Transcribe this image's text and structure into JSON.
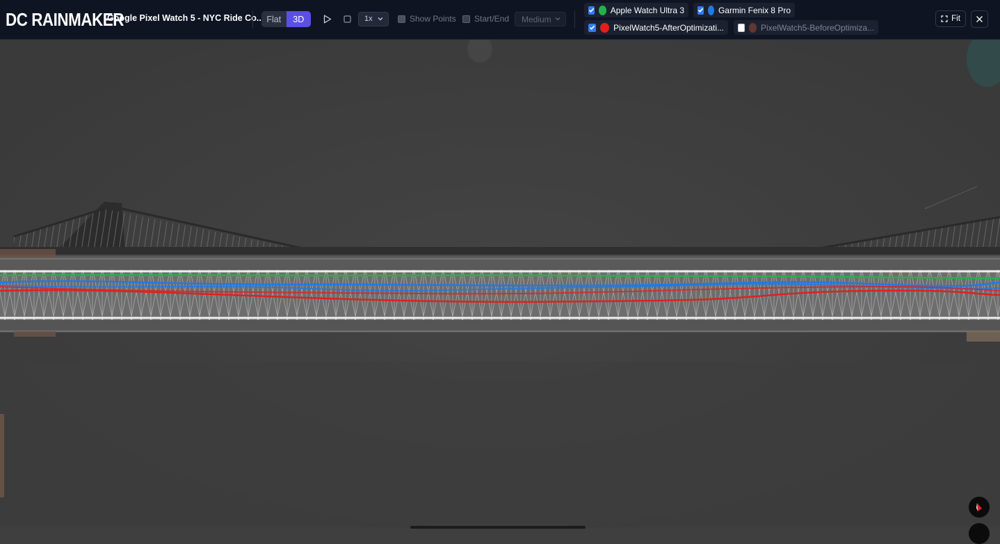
{
  "brand": "DC RAINMAKER",
  "route_title": "Google Pixel Watch 5 - NYC Ride Co...",
  "view_toggle": {
    "flat_label": "Flat",
    "three_d_label": "3D",
    "active": "3D"
  },
  "playback": {
    "play_icon": "play-icon",
    "stop_icon": "stop-icon",
    "speed_value": "1x"
  },
  "options": {
    "show_points_label": "Show Points",
    "start_end_label": "Start/End",
    "quality_value": "Medium"
  },
  "devices": [
    {
      "label": "Apple Watch Ultra 3",
      "color": "#22b24c",
      "checked": true
    },
    {
      "label": "Garmin Fenix 8 Pro",
      "color": "#1f7ae6",
      "checked": true
    },
    {
      "label": "PixelWatch5-AfterOptimizati...",
      "color": "#e0201f",
      "checked": true
    },
    {
      "label": "PixelWatch5-BeforeOptimiza...",
      "color": "#9a4a33",
      "checked": false
    }
  ],
  "fit_label": "Fit",
  "close_icon": "close-icon",
  "compass_icon": "compass-icon",
  "colors": {
    "topbar": "#0e1422",
    "accent": "#5b4fe6",
    "water": "#3f3f3f"
  }
}
